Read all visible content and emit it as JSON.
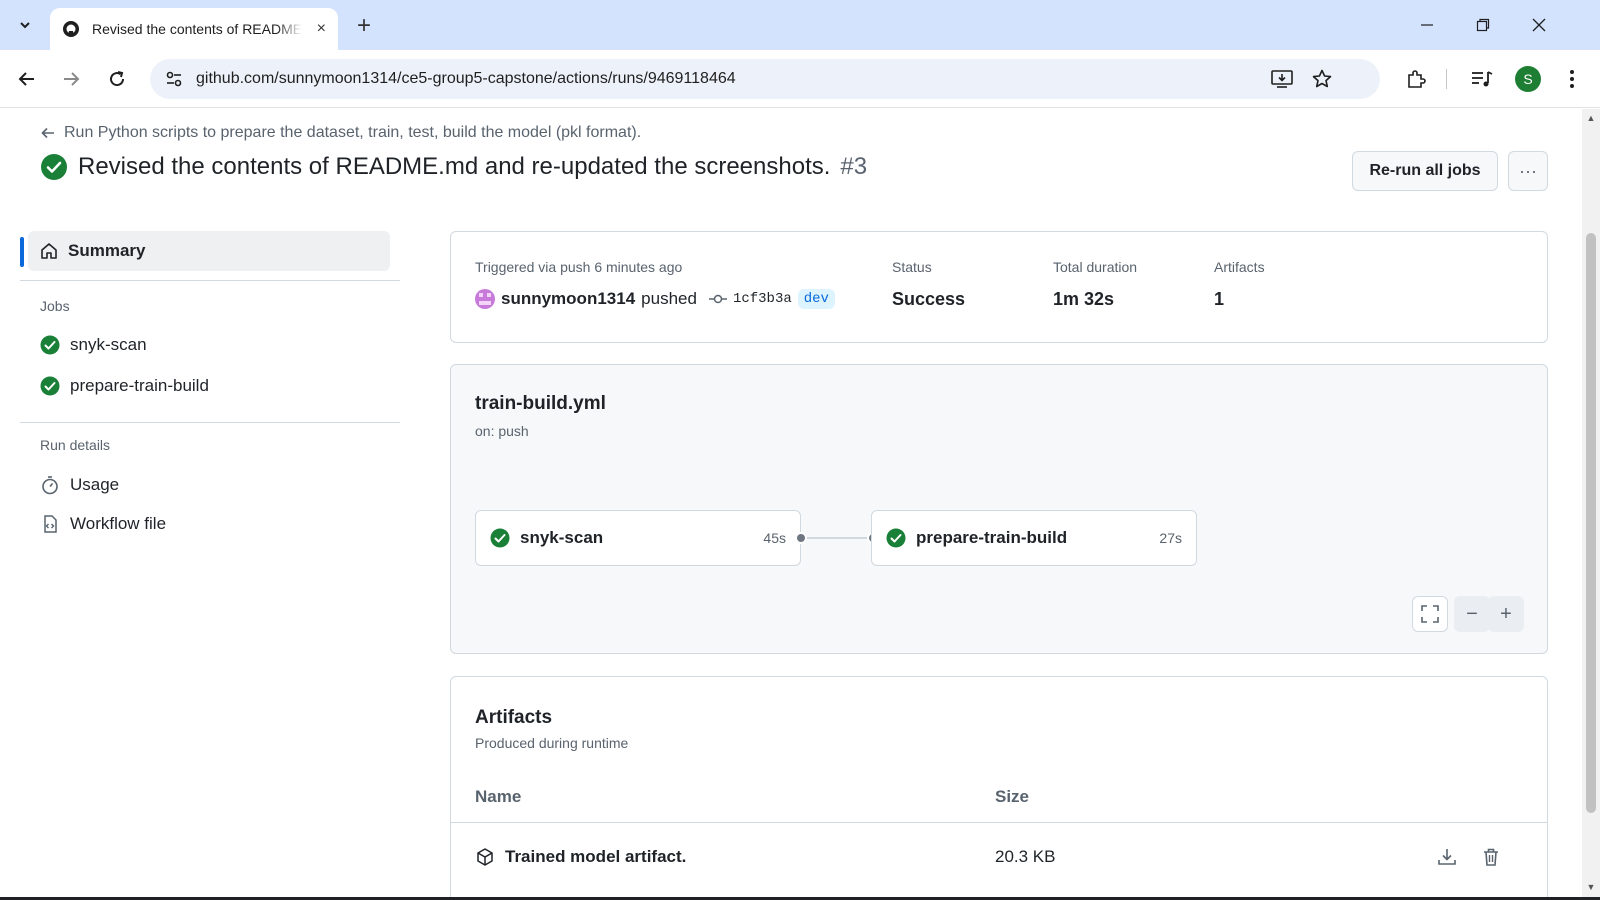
{
  "browser": {
    "tab_title": "Revised the contents of README.md and re-updated the screenshots. · sunnymoon1314/ce5-group5-capstone",
    "url": "github.com/sunnymoon1314/ce5-group5-capstone/actions/runs/9469118464",
    "profile_initial": "S",
    "new_tab": "+",
    "tab_close": "×"
  },
  "header": {
    "back_link": "Run Python scripts to prepare the dataset, train, test, build the model (pkl format).",
    "run_title": "Revised the contents of README.md and re-updated the screenshots.",
    "run_number": "#3",
    "rerun_label": "Re-run all jobs",
    "more_label": "···"
  },
  "sidebar": {
    "summary_label": "Summary",
    "jobs_heading": "Jobs",
    "jobs": [
      {
        "label": "snyk-scan"
      },
      {
        "label": "prepare-train-build"
      }
    ],
    "run_details_heading": "Run details",
    "details": [
      {
        "label": "Usage",
        "icon": "stopwatch-icon"
      },
      {
        "label": "Workflow file",
        "icon": "file-code-icon"
      }
    ]
  },
  "summary": {
    "trigger_text": "Triggered via push 6 minutes ago",
    "actor": "sunnymoon1314",
    "action": "pushed",
    "commit": "1cf3b3a",
    "branch": "dev",
    "status_label": "Status",
    "status_value": "Success",
    "duration_label": "Total duration",
    "duration_value": "1m 32s",
    "artifacts_label": "Artifacts",
    "artifacts_value": "1"
  },
  "workflow": {
    "file": "train-build.yml",
    "trigger": "on: push",
    "jobs": [
      {
        "name": "snyk-scan",
        "duration": "45s"
      },
      {
        "name": "prepare-train-build",
        "duration": "27s"
      }
    ],
    "zoom_out": "−",
    "zoom_in": "+"
  },
  "artifacts": {
    "title": "Artifacts",
    "subtitle": "Produced during runtime",
    "col_name": "Name",
    "col_size": "Size",
    "rows": [
      {
        "name": "Trained model artifact.",
        "size": "20.3 KB"
      }
    ]
  },
  "colors": {
    "success": "#1a7f37",
    "accent": "#0969da",
    "chrome": "#d3e3fd"
  }
}
